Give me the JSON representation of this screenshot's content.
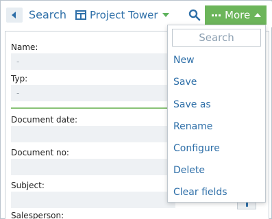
{
  "toolbar": {
    "back_label": "Search",
    "project_label": "Project Tower",
    "more_label": "More"
  },
  "form": {
    "fields": [
      {
        "label": "Name:",
        "value": "-"
      },
      {
        "label": "Typ:",
        "value": "-"
      },
      {
        "label": "Document date:",
        "value": ""
      },
      {
        "label": "Document no:",
        "value": ""
      },
      {
        "label": "Subject:",
        "value": ""
      },
      {
        "label": "Salesperson:",
        "value": ""
      }
    ]
  },
  "menu": {
    "search_placeholder": "Search",
    "items": [
      "New",
      "Save",
      "Save as",
      "Rename",
      "Configure",
      "Delete",
      "Clear fields"
    ]
  },
  "colors": {
    "accent_blue": "#2e6fa8",
    "more_green": "#6cb55a"
  }
}
